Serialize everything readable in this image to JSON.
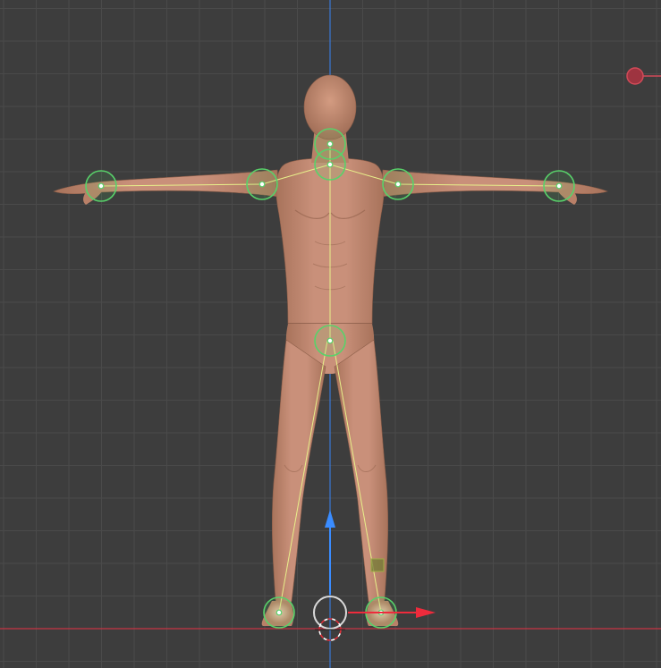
{
  "viewport": {
    "background_color": "#3d3d3d",
    "grid_color": "#4a4a4a",
    "axis_y_color": "#3a78d6",
    "axis_x_color": "#c73444"
  },
  "figure": {
    "skin_color": "#c4896e",
    "skin_shadow": "#9c6a53",
    "skin_highlight": "#dba58a"
  },
  "rig": {
    "joint_color": "#58d26a",
    "bone_color": "#e8f08a",
    "joints": [
      "neck",
      "chest",
      "left-shoulder",
      "right-shoulder",
      "left-wrist",
      "right-wrist",
      "hips",
      "left-ankle",
      "right-ankle"
    ]
  },
  "gizmo": {
    "up_arrow_color": "#3a8cff",
    "right_arrow_color": "#ee2b3c",
    "origin_ring_color": "#d9d9d9",
    "cursor_color": "#e0303a"
  }
}
